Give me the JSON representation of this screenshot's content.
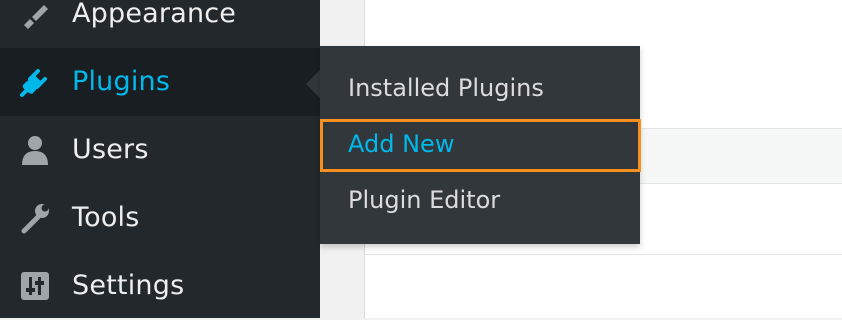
{
  "sidebar": {
    "items": [
      {
        "label": "Appearance",
        "icon": "paintbrush-icon"
      },
      {
        "label": "Plugins",
        "icon": "plugin-plug-icon",
        "active": true
      },
      {
        "label": "Users",
        "icon": "user-icon"
      },
      {
        "label": "Tools",
        "icon": "wrench-icon"
      },
      {
        "label": "Settings",
        "icon": "sliders-icon"
      }
    ]
  },
  "submenu": {
    "items": [
      {
        "label": "Installed Plugins"
      },
      {
        "label": "Add New",
        "highlighted": true
      },
      {
        "label": "Plugin Editor"
      }
    ]
  },
  "colors": {
    "sidebar_bg": "#23282d",
    "active_bg": "#191e23",
    "accent": "#00b9eb",
    "flyout_bg": "#32373c",
    "highlight": "#f7901e"
  }
}
